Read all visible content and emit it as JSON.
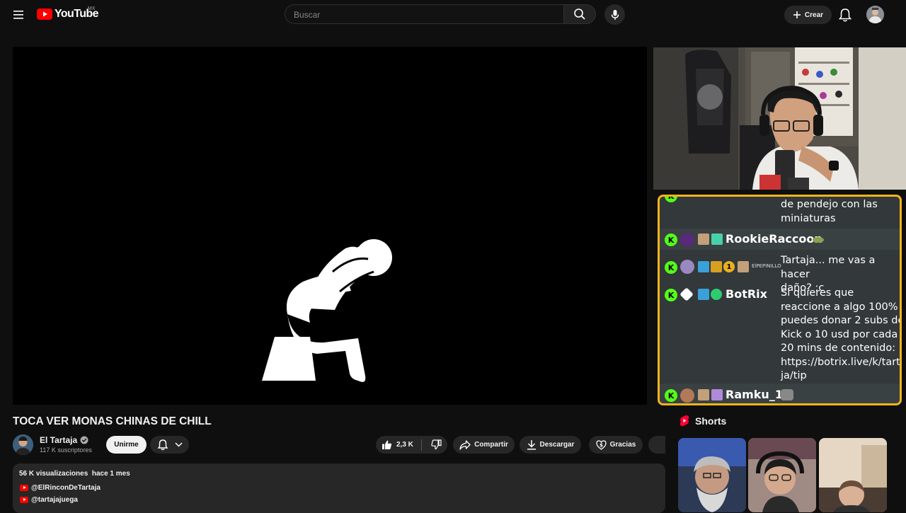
{
  "header": {
    "logo_text": "YouTube",
    "country_code": "MX",
    "search_placeholder": "Buscar",
    "create_label": "Crear"
  },
  "chat": {
    "messages": [
      {
        "username": "",
        "text_lines": [
          "de pendejo con las",
          "miniaturas"
        ]
      },
      {
        "username": "RookieRaccoon",
        "text_lines": []
      },
      {
        "username": "",
        "badge_count": "1",
        "badge_label": "ElPEPINILLO",
        "text_lines": [
          "Tartaja... me vas a hacer",
          "daño? :c"
        ]
      },
      {
        "username": "BotRix",
        "text_lines": [
          "Si quieres que",
          "reaccione a algo 100%",
          "puedes donar 2 subs de",
          "Kick o 10 usd por cada",
          "20 mins de contenido:",
          "https://botrix.live/k/tarta",
          "ja/tip"
        ]
      },
      {
        "username": "Ramku_1",
        "text_lines": []
      }
    ],
    "border_color": "#f3b51c",
    "kick_color": "#53fc18"
  },
  "video": {
    "title": "TOCA VER MONAS CHINAS DE CHILL"
  },
  "channel": {
    "name": "El Tartaja",
    "subscribers": "117 K suscriptores",
    "join_label": "Unirme"
  },
  "actions": {
    "likes": "2,3 K",
    "share_label": "Compartir",
    "download_label": "Descargar",
    "thanks_label": "Gracias"
  },
  "description": {
    "views": "56 K visualizaciones",
    "date": "hace 1 mes",
    "links": [
      "@ElRinconDeTartaja",
      "@tartajajuega"
    ]
  },
  "shorts": {
    "heading": "Shorts"
  }
}
